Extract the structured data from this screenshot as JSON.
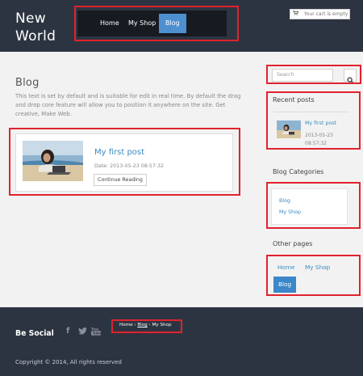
{
  "header": {
    "brand_line1": "New",
    "brand_line2": "World",
    "nav": [
      {
        "label": "Home"
      },
      {
        "label": "My Shop"
      },
      {
        "label": "Blog",
        "active": true
      }
    ],
    "cart_text": "Your cart is empty"
  },
  "main": {
    "title": "Blog",
    "intro": "This text is set by default and is suitable for edit in real time. By default the drag and drop core feature will allow you to position it anywhere on the site. Get creative, Make Web.",
    "post": {
      "title": "My first post",
      "date": "Date: 2013-05-23 08:57:32",
      "button": "Continue Reading",
      "thumb_icon": "woman-with-laptop-photo"
    }
  },
  "sidebar": {
    "search_placeholder": "Search",
    "search_icon": "search-icon",
    "recent_heading": "Recent posts",
    "recent": {
      "title": "My first post",
      "date_line1": "2013-05-23",
      "date_line2": "08:57:32"
    },
    "categories_heading": "Blog Categories",
    "categories": [
      {
        "label": "Blog"
      },
      {
        "label": "My Shop"
      }
    ],
    "pages_heading": "Other pages",
    "pages": [
      {
        "label": "Home"
      },
      {
        "label": "My Shop"
      },
      {
        "label": "Blog",
        "active": true
      }
    ]
  },
  "footer": {
    "social_label": "Be Social",
    "social_icons": [
      "facebook-icon",
      "twitter-icon",
      "youtube-icon"
    ],
    "breadcrumb": {
      "home": "Home",
      "sep1": "›",
      "blog": "Blog",
      "sep2": "›",
      "shop": "My Shop"
    },
    "copyright": "Copyright © 2014, All rights reserved"
  },
  "colors": {
    "header_bg": "#2d3441",
    "nav_bg": "#161a21",
    "accent": "#3a87c9",
    "link": "#3a8bbf",
    "highlight_outline": "#e0222d",
    "page_bg": "#f2f2f2"
  }
}
